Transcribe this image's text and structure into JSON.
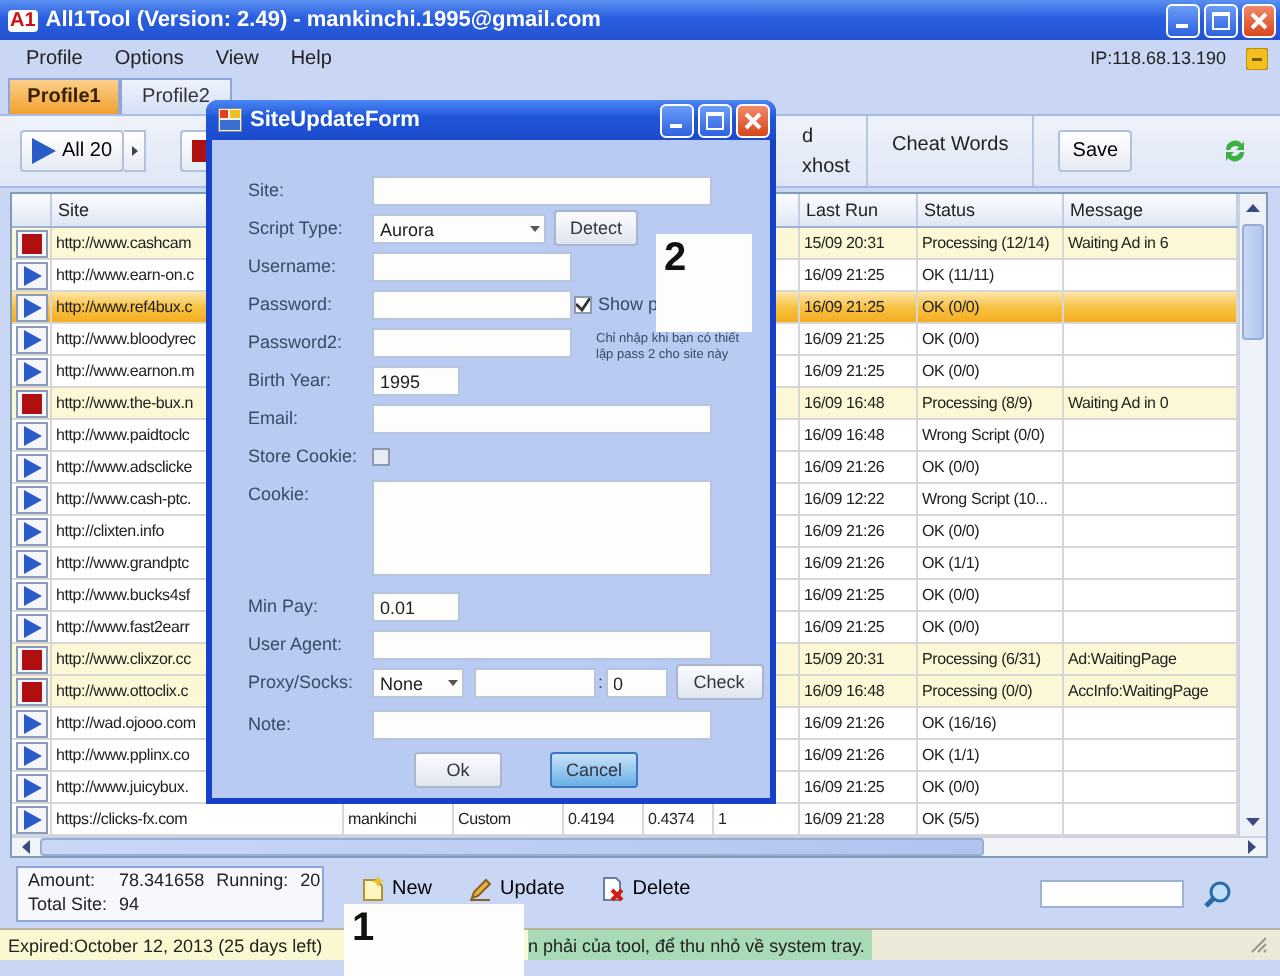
{
  "window": {
    "logo": "A1",
    "title": "All1Tool (Version: 2.49) - mankinchi.1995@gmail.com"
  },
  "menu": [
    "Profile",
    "Options",
    "View",
    "Help"
  ],
  "ip": "IP:118.68.13.190",
  "profile_tabs": [
    {
      "label": "Profile1",
      "selected": true
    },
    {
      "label": "Profile2",
      "selected": false
    }
  ],
  "toolbar": {
    "run_button": "All 20",
    "partial_labels": [
      "d",
      "xhost"
    ],
    "cheat_words": "Cheat Words",
    "save": "Save"
  },
  "table": {
    "columns": [
      {
        "label": "Site"
      },
      {
        "label": "Last Run"
      },
      {
        "label": "Status"
      },
      {
        "label": "Message"
      }
    ],
    "rows": [
      {
        "kind": "stop",
        "site": "http://www.cashcam",
        "last_run": "15/09 20:31",
        "status": "Processing (12/14)",
        "message": "Waiting Ad in 6",
        "highlighted": true,
        "selected": false
      },
      {
        "kind": "play",
        "site": "http://www.earn-on.c",
        "last_run": "16/09 21:25",
        "status": "OK (11/11)",
        "highlighted": false,
        "selected": false
      },
      {
        "kind": "play",
        "site": "http://www.ref4bux.c",
        "last_run": "16/09 21:25",
        "status": "OK (0/0)",
        "highlighted": false,
        "selected": true
      },
      {
        "kind": "play",
        "site": "http://www.bloodyrec",
        "last_run": "16/09 21:25",
        "status": "OK (0/0)",
        "highlighted": false,
        "selected": false
      },
      {
        "kind": "play",
        "site": "http://www.earnon.m",
        "last_run": "16/09 21:25",
        "status": "OK (0/0)",
        "highlighted": false,
        "selected": false
      },
      {
        "kind": "stop",
        "site": "http://www.the-bux.n",
        "last_run": "16/09 16:48",
        "status": "Processing (8/9)",
        "message": "Waiting Ad in 0",
        "highlighted": true,
        "selected": false
      },
      {
        "kind": "play",
        "site": "http://www.paidtoclc",
        "last_run": "16/09 16:48",
        "status": "Wrong Script (0/0)",
        "highlighted": false,
        "selected": false
      },
      {
        "kind": "play",
        "site": "http://www.adsclicke",
        "last_run": "16/09 21:26",
        "status": "OK (0/0)",
        "highlighted": false,
        "selected": false
      },
      {
        "kind": "play",
        "site": "http://www.cash-ptc.",
        "last_run": "16/09 12:22",
        "status": "Wrong Script (10...",
        "highlighted": false,
        "selected": false
      },
      {
        "kind": "play",
        "site": "http://clixten.info",
        "last_run": "16/09 21:26",
        "status": "OK (0/0)",
        "highlighted": false,
        "selected": false
      },
      {
        "kind": "play",
        "site": "http://www.grandptc",
        "last_run": "16/09 21:26",
        "status": "OK (1/1)",
        "highlighted": false,
        "selected": false
      },
      {
        "kind": "play",
        "site": "http://www.bucks4sf",
        "last_run": "16/09 21:25",
        "status": "OK (0/0)",
        "highlighted": false,
        "selected": false
      },
      {
        "kind": "play",
        "site": "http://www.fast2earr",
        "last_run": "16/09 21:25",
        "status": "OK (0/0)",
        "highlighted": false,
        "selected": false
      },
      {
        "kind": "stop",
        "site": "http://www.clixzor.cc",
        "last_run": "15/09 20:31",
        "status": "Processing (6/31)",
        "message": "Ad:WaitingPage",
        "highlighted": true,
        "selected": false
      },
      {
        "kind": "stop",
        "site": "http://www.ottoclix.c",
        "last_run": "16/09 16:48",
        "status": "Processing (0/0)",
        "message": "AccInfo:WaitingPage",
        "highlighted": true,
        "selected": false
      },
      {
        "kind": "play",
        "site": "http://wad.ojooo.com",
        "last_run": "16/09 21:26",
        "status": "OK (16/16)",
        "highlighted": false,
        "selected": false
      },
      {
        "kind": "play",
        "site": "http://www.pplinx.co",
        "last_run": "16/09 21:26",
        "status": "OK (1/1)",
        "highlighted": false,
        "selected": false
      },
      {
        "kind": "play",
        "site": "http://www.juicybux.",
        "last_run": "16/09 21:25",
        "status": "OK (0/0)",
        "highlighted": false,
        "selected": false
      },
      {
        "kind": "play",
        "site": "https://clicks-fx.com",
        "middle_cells": [
          "mankinchi",
          "Custom",
          "0.4194",
          "0.4374",
          "1"
        ],
        "last_run": "16/09 21:28",
        "status": "OK (5/5)",
        "highlighted": false,
        "selected": false
      }
    ]
  },
  "summary": {
    "amount_label": "Amount:",
    "amount": "78.341658",
    "running_label": "Running:",
    "running": "20",
    "total_label": "Total Site:",
    "total": "94"
  },
  "actions": [
    {
      "label": "New",
      "kind": "new"
    },
    {
      "label": "Update",
      "kind": "update"
    },
    {
      "label": "Delete",
      "kind": "delete"
    }
  ],
  "status_bar": {
    "expiry": "Expired:October 12, 2013 (25 days left)",
    "message": "n phải của tool, để thu nhỏ về system tray."
  },
  "dialog": {
    "title": "SiteUpdateForm",
    "fields": [
      {
        "label": "Site:",
        "kind": "text"
      },
      {
        "label": "Script Type:",
        "kind": "select",
        "value": "Aurora",
        "button": "Detect"
      },
      {
        "label": "Username:",
        "kind": "medium"
      },
      {
        "label": "Password:",
        "kind": "password"
      },
      {
        "label": "Password2:",
        "kind": "password2"
      },
      {
        "label": "Birth Year:",
        "kind": "short",
        "value": "1995"
      },
      {
        "label": "Email:",
        "kind": "text"
      },
      {
        "label": "Store Cookie:",
        "kind": "checkbox",
        "checked": false
      },
      {
        "label": "Cookie:",
        "kind": "textarea"
      },
      {
        "label": "Min Pay:",
        "kind": "short",
        "value": "0.01"
      },
      {
        "label": "User Agent:",
        "kind": "text"
      },
      {
        "label": "Proxy/Socks:",
        "kind": "proxy",
        "value": "None",
        "separator": ":",
        "port": "0",
        "button": "Check"
      },
      {
        "label": "Note:",
        "kind": "text"
      }
    ],
    "show_password": {
      "label": "Show p",
      "checked": true
    },
    "hint": "Chỉ nhập khi bạn có thiết lập pass 2 cho site này",
    "buttons": [
      {
        "label": "Ok",
        "focused": false
      },
      {
        "label": "Cancel",
        "focused": true
      }
    ]
  },
  "annotations": [
    {
      "label": "1"
    },
    {
      "label": "2"
    }
  ]
}
